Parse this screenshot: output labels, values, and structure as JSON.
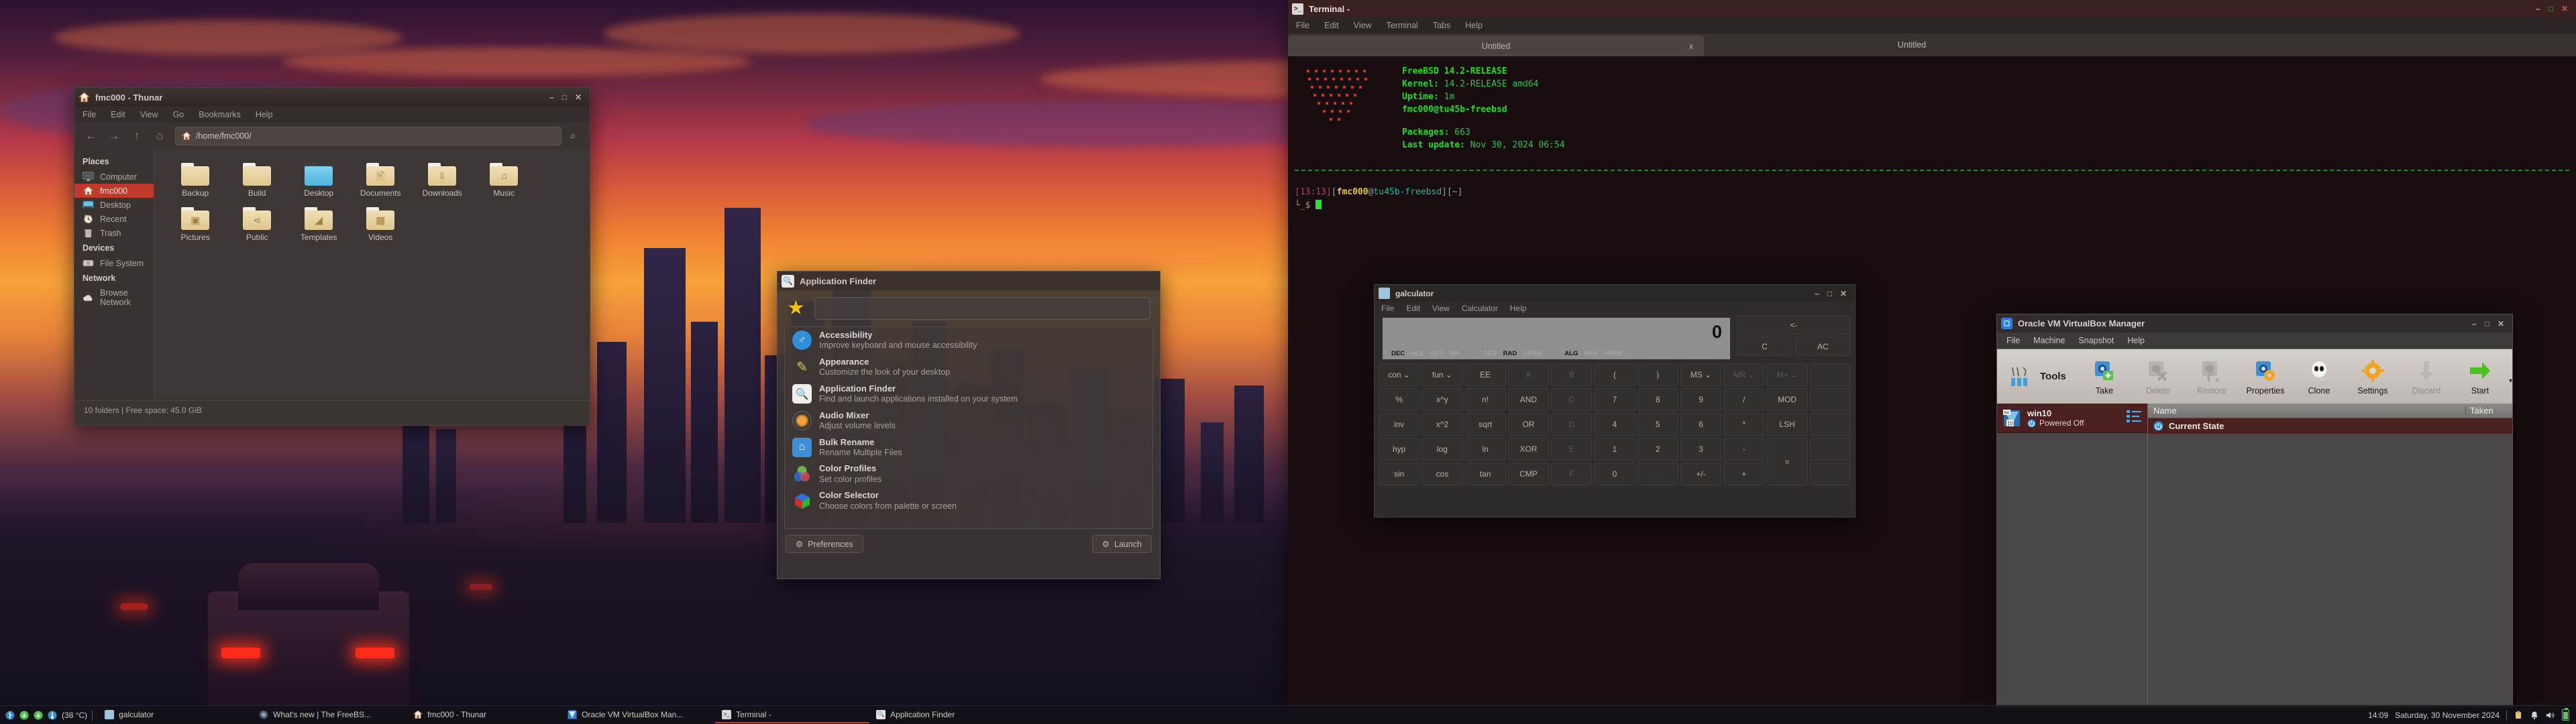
{
  "desktop": {
    "name": "xfce-desktop"
  },
  "thunar": {
    "title": "fmc000 - Thunar",
    "menu": [
      "File",
      "Edit",
      "View",
      "Go",
      "Bookmarks",
      "Help"
    ],
    "path": "/home/fmc000/",
    "nav": {
      "back": "←",
      "forward": "→",
      "up": "↑",
      "home": "⌂",
      "search": "⌕"
    },
    "sidebar": [
      {
        "type": "header",
        "label": "Places"
      },
      {
        "type": "item",
        "label": "Computer",
        "icon": "computer-icon",
        "active": false
      },
      {
        "type": "item",
        "label": "fmc000",
        "icon": "home-icon",
        "active": true
      },
      {
        "type": "item",
        "label": "Desktop",
        "icon": "desktop-icon",
        "active": false
      },
      {
        "type": "item",
        "label": "Recent",
        "icon": "clock-icon",
        "active": false
      },
      {
        "type": "item",
        "label": "Trash",
        "icon": "trash-icon",
        "active": false
      },
      {
        "type": "header",
        "label": "Devices"
      },
      {
        "type": "item",
        "label": "File System",
        "icon": "harddisk-icon",
        "active": false
      },
      {
        "type": "header",
        "label": "Network"
      },
      {
        "type": "item",
        "label": "Browse Network",
        "icon": "cloud-icon",
        "active": false
      }
    ],
    "folders": [
      {
        "name": "Backup",
        "style": "plain",
        "emblem": ""
      },
      {
        "name": "Build",
        "style": "plain",
        "emblem": ""
      },
      {
        "name": "Desktop",
        "style": "blue",
        "emblem": ""
      },
      {
        "name": "Documents",
        "style": "plain",
        "emblem": "὜b"
      },
      {
        "name": "Downloads",
        "style": "plain",
        "emblem": "↓"
      },
      {
        "name": "Music",
        "style": "plain",
        "emblem": "♫"
      },
      {
        "name": "Pictures",
        "style": "plain",
        "emblem": "◱"
      },
      {
        "name": "Public",
        "style": "plain",
        "emblem": "⎇"
      },
      {
        "name": "Templates",
        "style": "plain",
        "emblem": "◢"
      },
      {
        "name": "Videos",
        "style": "plain",
        "emblem": "☰"
      }
    ],
    "status": "10 folders  |  Free space: 45.0 GiB",
    "window_buttons": {
      "minimize": "–",
      "maximize": "□",
      "close": "✕"
    }
  },
  "appfinder": {
    "title": "Application Finder",
    "search_value": "",
    "search_placeholder": "",
    "items": [
      {
        "title": "Accessibility",
        "subtitle": "Improve keyboard and mouse accessibility",
        "icon": "accessibility-icon",
        "color": "#2f8fd8",
        "glyph": "⛹"
      },
      {
        "title": "Appearance",
        "subtitle": "Customize the look of your desktop",
        "icon": "appearance-icon",
        "color": "#e8c84b",
        "glyph": "✎"
      },
      {
        "title": "Application Finder",
        "subtitle": "Find and launch applications installed on your system",
        "icon": "search-icon",
        "color": "#e8e8e8",
        "glyph": "🔍"
      },
      {
        "title": "Audio Mixer",
        "subtitle": "Adjust volume levels",
        "icon": "audio-mixer-icon",
        "color": "#e08a22",
        "glyph": "◉"
      },
      {
        "title": "Bulk Rename",
        "subtitle": "Rename Multiple Files",
        "icon": "bulk-rename-icon",
        "color": "#3b8fd8",
        "glyph": "⌂"
      },
      {
        "title": "Color Profiles",
        "subtitle": "Set color profiles",
        "icon": "color-profiles-icon",
        "color": "#6ac04a",
        "glyph": "⬤"
      },
      {
        "title": "Color Selector",
        "subtitle": "Choose colors from palette or screen",
        "icon": "color-selector-icon",
        "color": "#3b6fd8",
        "glyph": "⬟"
      }
    ],
    "preferences_label": "Preferences",
    "launch_label": "Launch",
    "preferences_icon": "gear-icon",
    "launch_icon": "launch-icon"
  },
  "terminal": {
    "title": "Terminal -",
    "menu": [
      "File",
      "Edit",
      "View",
      "Terminal",
      "Tabs",
      "Help"
    ],
    "tabs": [
      {
        "label": "Untitled",
        "active": true,
        "close": "x"
      },
      {
        "label": "Untitled",
        "active": false,
        "close": ""
      }
    ],
    "fetch": {
      "line1": "FreeBSD 14.2-RELEASE",
      "kernel_label": "Kernel:",
      "kernel_value": "14.2-RELEASE amd64",
      "uptime_label": "Uptime:",
      "uptime_value": "1m",
      "user_host": "fmc000@tu45b-freebsd",
      "packages_label": "Packages:",
      "packages_value": "663",
      "update_label": "Last update:",
      "update_value": "Nov 30, 2024 06:54"
    },
    "prompt": {
      "time": "[13:13]",
      "user": "fmc000",
      "at": "@",
      "host": "tu45b-freebsd",
      "cwd": "[~]",
      "symbol": "└_$"
    },
    "window_buttons": {
      "minimize": "–",
      "maximize": "□",
      "close": "✕"
    }
  },
  "galculator": {
    "title": "galculator",
    "menu": [
      "File",
      "Edit",
      "View",
      "Calculator",
      "Help"
    ],
    "display_value": "0",
    "modes": [
      {
        "label": "DEC",
        "on": true
      },
      {
        "label": "HEX",
        "on": false
      },
      {
        "label": "OCT",
        "on": false
      },
      {
        "label": "BIN",
        "on": false
      },
      {
        "label": "DEG",
        "on": false
      },
      {
        "label": "RAD",
        "on": true
      },
      {
        "label": "GRAD",
        "on": false
      },
      {
        "label": "ALG",
        "on": true
      },
      {
        "label": "RPN",
        "on": false
      },
      {
        "label": "FORM",
        "on": false
      }
    ],
    "top_keys": [
      {
        "label": "<-",
        "dim": false
      },
      {
        "label": "C",
        "dim": false
      },
      {
        "label": "AC",
        "dim": false
      }
    ],
    "keys": [
      [
        {
          "l": "con ⌄"
        },
        {
          "l": "fun ⌄"
        },
        {
          "l": "EE"
        },
        {
          "l": "A",
          "d": true
        },
        {
          "l": "B",
          "d": true
        },
        {
          "l": "("
        },
        {
          "l": ")"
        },
        {
          "l": "MS ⌄"
        },
        {
          "l": "MR ⌄",
          "d": true
        },
        {
          "l": "M+ ⌄",
          "d": true
        },
        {
          "l": "",
          "d": true
        }
      ],
      [
        {
          "l": "%"
        },
        {
          "l": "x^y"
        },
        {
          "l": "n!"
        },
        {
          "l": "AND"
        },
        {
          "l": "C",
          "d": true
        },
        {
          "l": "7"
        },
        {
          "l": "8"
        },
        {
          "l": "9"
        },
        {
          "l": "/"
        },
        {
          "l": "MOD"
        },
        {
          "l": "",
          "d": true
        }
      ],
      [
        {
          "l": "inv"
        },
        {
          "l": "x^2"
        },
        {
          "l": "sqrt"
        },
        {
          "l": "OR"
        },
        {
          "l": "D",
          "d": true
        },
        {
          "l": "4"
        },
        {
          "l": "5"
        },
        {
          "l": "6"
        },
        {
          "l": "*"
        },
        {
          "l": "LSH"
        },
        {
          "l": "",
          "d": true
        }
      ],
      [
        {
          "l": "hyp"
        },
        {
          "l": "log"
        },
        {
          "l": "ln"
        },
        {
          "l": "XOR"
        },
        {
          "l": "E",
          "d": true
        },
        {
          "l": "1"
        },
        {
          "l": "2"
        },
        {
          "l": "3"
        },
        {
          "l": "-"
        },
        {
          "l": "=",
          "span": true
        },
        {
          "l": "",
          "d": true
        }
      ],
      [
        {
          "l": "sin"
        },
        {
          "l": "cos"
        },
        {
          "l": "tan"
        },
        {
          "l": "CMP"
        },
        {
          "l": "F",
          "d": true
        },
        {
          "l": "0"
        },
        {
          "l": ".",
          "d": true
        },
        {
          "l": "+/-"
        },
        {
          "l": "+"
        },
        {
          "l": "",
          "d": true
        }
      ]
    ],
    "window_buttons": {
      "minimize": "–",
      "maximize": "□",
      "close": "✕"
    }
  },
  "virtualbox": {
    "title": "Oracle VM VirtualBox Manager",
    "menu": [
      "File",
      "Machine",
      "Snapshot",
      "Help"
    ],
    "tools_label": "Tools",
    "tools_icon": "tools-icon",
    "actions": [
      {
        "label": "Take",
        "icon": "snapshot-take-icon",
        "disabled": false
      },
      {
        "label": "Delete",
        "icon": "snapshot-delete-icon",
        "disabled": true
      },
      {
        "label": "Restore",
        "icon": "snapshot-restore-icon",
        "disabled": true
      },
      {
        "label": "Properties",
        "icon": "properties-icon",
        "disabled": false
      },
      {
        "label": "Clone",
        "icon": "clone-icon",
        "disabled": false
      },
      {
        "label": "Settings",
        "icon": "gear-icon",
        "disabled": false
      },
      {
        "label": "Discard",
        "icon": "discard-arrow-icon",
        "disabled": true
      },
      {
        "label": "Start",
        "icon": "start-arrow-icon",
        "disabled": false
      }
    ],
    "vm": {
      "name": "win10",
      "state": "Powered Off",
      "badge": "64",
      "os": "10"
    },
    "snapshot_columns": [
      "Name",
      "Taken"
    ],
    "snapshot_rows": [
      {
        "name": "Current State",
        "taken": ""
      }
    ],
    "window_buttons": {
      "minimize": "–",
      "maximize": "□",
      "close": "✕"
    }
  },
  "taskbar": {
    "tray_left": [
      {
        "icon": "bluetooth-icon",
        "label": ""
      },
      {
        "icon": "updates-icon",
        "label": ""
      },
      {
        "icon": "updates2-icon",
        "label": ""
      },
      {
        "icon": "thermometer-icon",
        "label": "(38 °C)"
      }
    ],
    "tasks": [
      {
        "label": "galculator",
        "icon": "galculator-icon",
        "active": false
      },
      {
        "label": "What's new | The FreeBS...",
        "icon": "firefox-icon",
        "active": false
      },
      {
        "label": "fmc000 - Thunar",
        "icon": "thunar-icon",
        "active": false
      },
      {
        "label": "Oracle VM VirtualBox Man...",
        "icon": "virtualbox-icon",
        "active": false
      },
      {
        "label": "Terminal -",
        "icon": "terminal-icon",
        "active": true
      },
      {
        "label": "Application Finder",
        "icon": "search-icon",
        "active": false
      }
    ],
    "clock_time": "14:09",
    "clock_date": "Saturday, 30 November 2024",
    "tray_right": [
      {
        "icon": "clipman-icon"
      },
      {
        "icon": "notification-bell-icon"
      },
      {
        "icon": "volume-icon"
      },
      {
        "icon": "battery-icon"
      }
    ]
  },
  "colors": {
    "accent_red": "#c0392b",
    "window_bg": "#393331",
    "terminal_green": "#22dd22",
    "vbox_selection": "#4a2020"
  }
}
